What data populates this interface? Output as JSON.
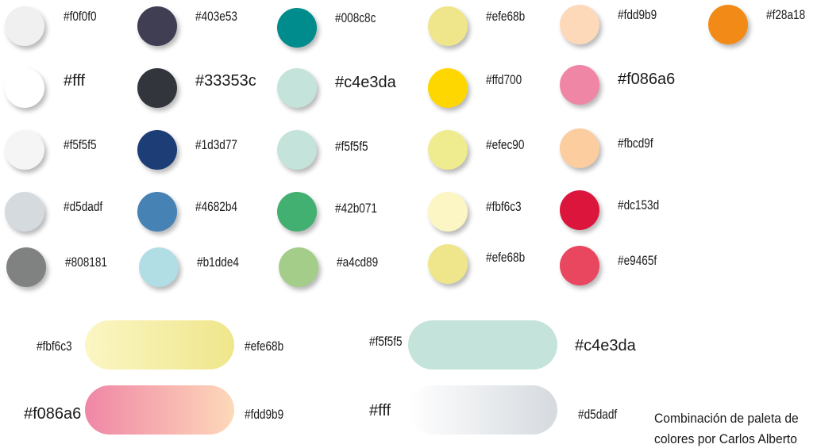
{
  "swatches": [
    {
      "hex": "#f0f0f0",
      "label": "#f0f0f0"
    },
    {
      "hex": "#ffffff",
      "label": "#fff"
    },
    {
      "hex": "#f5f5f5",
      "label": "#f5f5f5"
    },
    {
      "hex": "#d5dadf",
      "label": "#d5dadf"
    },
    {
      "hex": "#808181",
      "label": "#808181"
    },
    {
      "hex": "#403e53",
      "label": "#403e53"
    },
    {
      "hex": "#33353c",
      "label": "#33353c"
    },
    {
      "hex": "#1d3d77",
      "label": "#1d3d77"
    },
    {
      "hex": "#4682b4",
      "label": "#4682b4"
    },
    {
      "hex": "#b1dde4",
      "label": "#b1dde4"
    },
    {
      "hex": "#008c8c",
      "label": "#008c8c"
    },
    {
      "hex": "#c4e3da",
      "label": "#c4e3da"
    },
    {
      "hex": "#c4e3da",
      "label": "#f5f5f5"
    },
    {
      "hex": "#42b071",
      "label": "#42b071"
    },
    {
      "hex": "#a4cd89",
      "label": "#a4cd89"
    },
    {
      "hex": "#efe68b",
      "label": "#efe68b"
    },
    {
      "hex": "#ffd700",
      "label": "#ffd700"
    },
    {
      "hex": "#efec90",
      "label": "#efec90"
    },
    {
      "hex": "#fbf6c3",
      "label": "#fbf6c3"
    },
    {
      "hex": "#efe68b",
      "label": "#efe68b"
    },
    {
      "hex": "#fdd9b9",
      "label": "#fdd9b9"
    },
    {
      "hex": "#f086a6",
      "label": "#f086a6"
    },
    {
      "hex": "#fbcd9f",
      "label": "#fbcd9f"
    },
    {
      "hex": "#dc153d",
      "label": "#dc153d"
    },
    {
      "hex": "#e9465f",
      "label": "#e9465f"
    },
    {
      "hex": "#f28a18",
      "label": "#f28a18"
    }
  ],
  "gradients": [
    {
      "from": "#fbf6c3",
      "to": "#efe68b",
      "left_label": "#fbf6c3",
      "right_label": "#efe68b"
    },
    {
      "from": "#f086a6",
      "to": "#fdd9b9",
      "left_label": "#f086a6",
      "right_label": "#fdd9b9"
    },
    {
      "from": "#c4e3da",
      "to": "#c4e3da",
      "left_label": "#f5f5f5",
      "right_label": "#c4e3da"
    },
    {
      "from": "#ffffff",
      "to": "#d5dadf",
      "left_label": "#fff",
      "right_label": "#d5dadf"
    }
  ],
  "credit": {
    "line1": "Combinación de paleta de",
    "line2": "colores por Carlos Alberto"
  }
}
